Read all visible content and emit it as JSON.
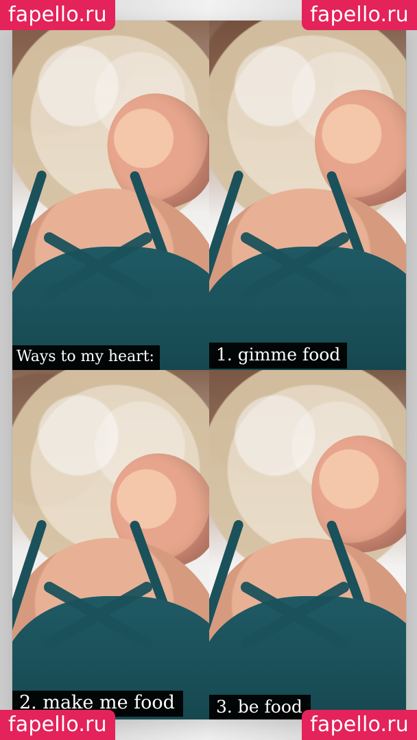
{
  "watermarks": {
    "top_left": "fapello.ru",
    "top_right": "fapello.ru",
    "bottom_left": "fapello.ru",
    "bottom_right": "fapello.ru"
  },
  "collage": {
    "captions": [
      "Ways to my heart:",
      "1. gimme food",
      "2. make me food",
      "3. be food"
    ]
  },
  "colors": {
    "watermark_bg": "#e3235a",
    "caption_bg": "#000000",
    "caption_text": "#ffffff",
    "top_color": "#1f5a64"
  }
}
